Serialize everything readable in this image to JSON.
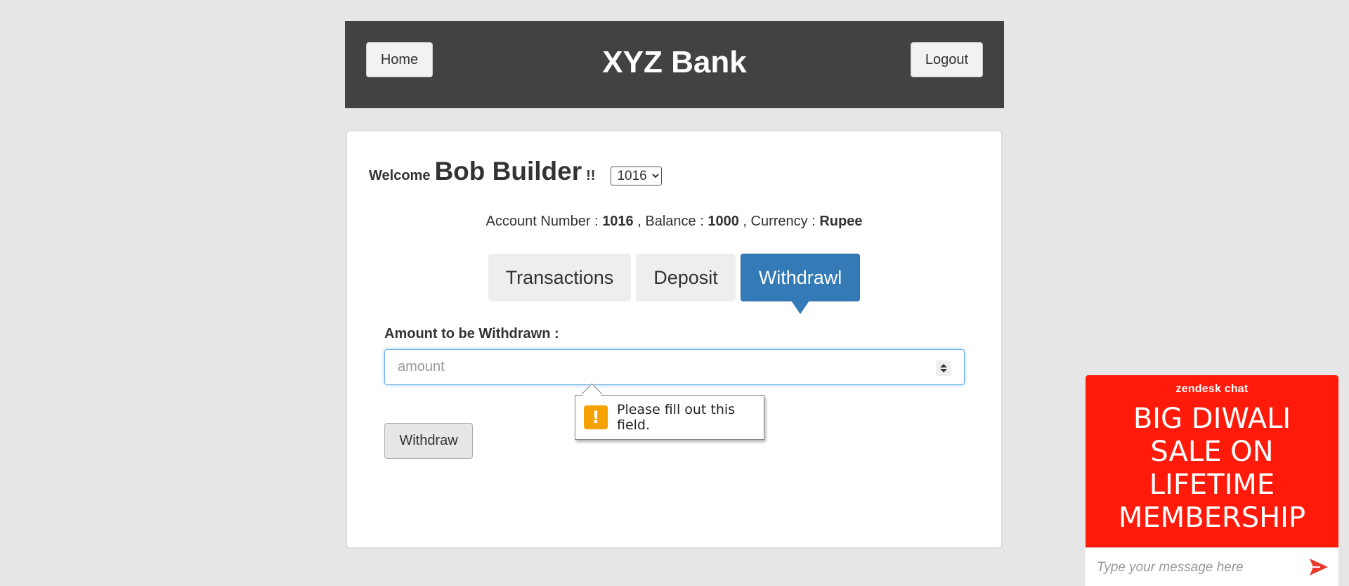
{
  "header": {
    "home_label": "Home",
    "title": "XYZ Bank",
    "logout_label": "Logout"
  },
  "welcome": {
    "label": "Welcome",
    "user_name": "Bob Builder",
    "suffix": "!!",
    "selected_account": "1016"
  },
  "account_info": {
    "account_number_label": "Account Number :",
    "account_number": "1016",
    "balance_label": ", Balance :",
    "balance": "1000",
    "currency_label": ", Currency :",
    "currency": "Rupee"
  },
  "tabs": [
    {
      "label": "Transactions",
      "active": false
    },
    {
      "label": "Deposit",
      "active": false
    },
    {
      "label": "Withdrawl",
      "active": true
    }
  ],
  "form": {
    "amount_label": "Amount to be Withdrawn :",
    "amount_placeholder": "amount",
    "amount_value": "",
    "validation_message": "Please fill out this field.",
    "submit_label": "Withdraw"
  },
  "chat": {
    "brand": "zendesk chat",
    "promo": "BIG DIWALI SALE ON LIFETIME MEMBERSHIP",
    "input_placeholder": "Type your message here"
  },
  "colors": {
    "header_bg": "#424242",
    "active_tab": "#337ab7",
    "chat_banner": "#ff1a0a",
    "warning_icon": "#f5a100"
  }
}
